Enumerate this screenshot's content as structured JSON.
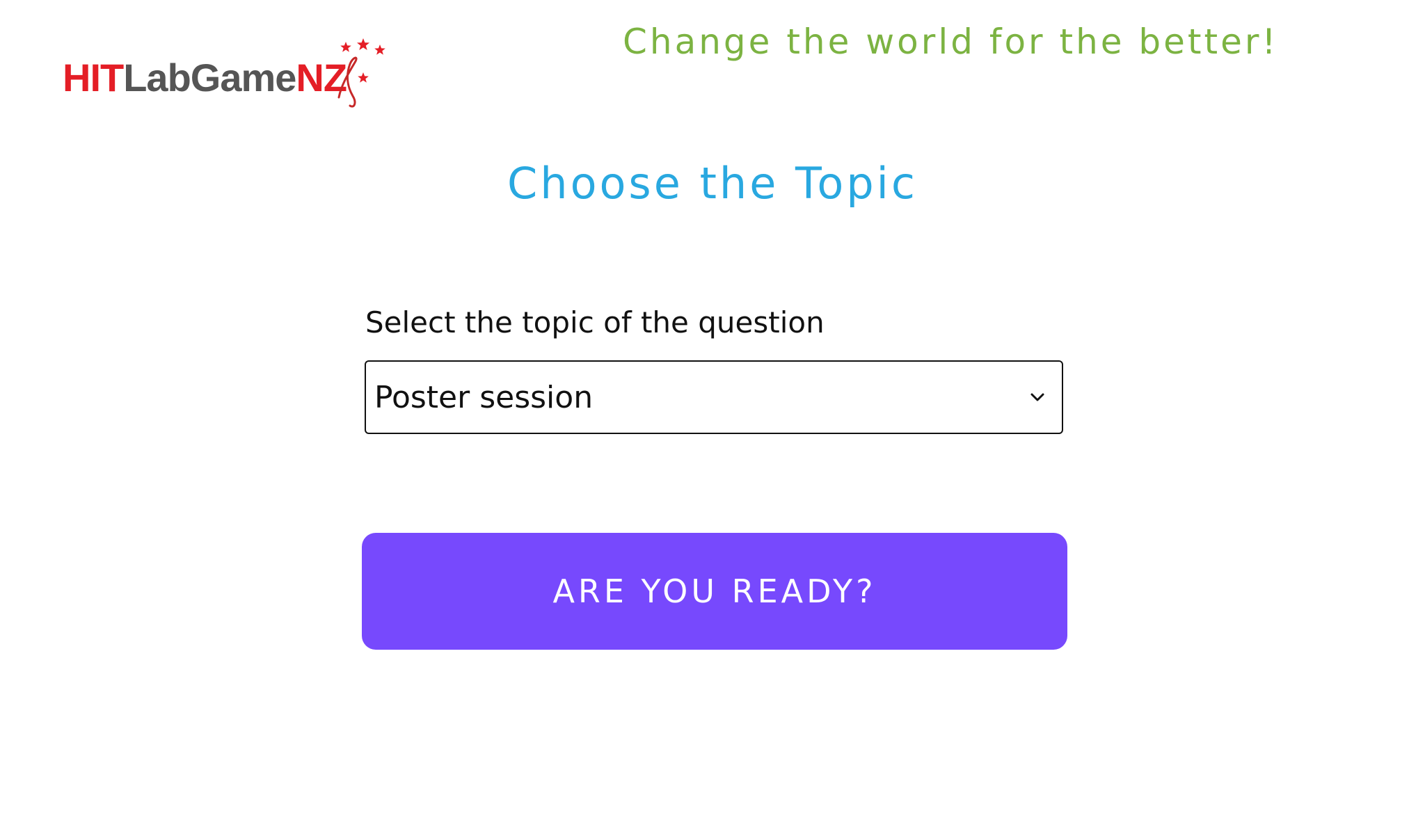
{
  "header": {
    "logo": {
      "part_red_1": "HIT",
      "part_gray": "LabGame",
      "part_red_2": "NZ",
      "brand_red": "#e41e26",
      "brand_gray": "#555555"
    },
    "tagline": "Change the world for the better!",
    "tagline_color": "#7cb342"
  },
  "main": {
    "title": "Choose the Topic",
    "title_color": "#29a8e0",
    "topic_select": {
      "label": "Select the topic of the question",
      "selected_value": "Poster session",
      "icon": "chevron-down-icon"
    },
    "ready_button": {
      "label": "ARE YOU READY?",
      "color": "#7749fd"
    }
  }
}
